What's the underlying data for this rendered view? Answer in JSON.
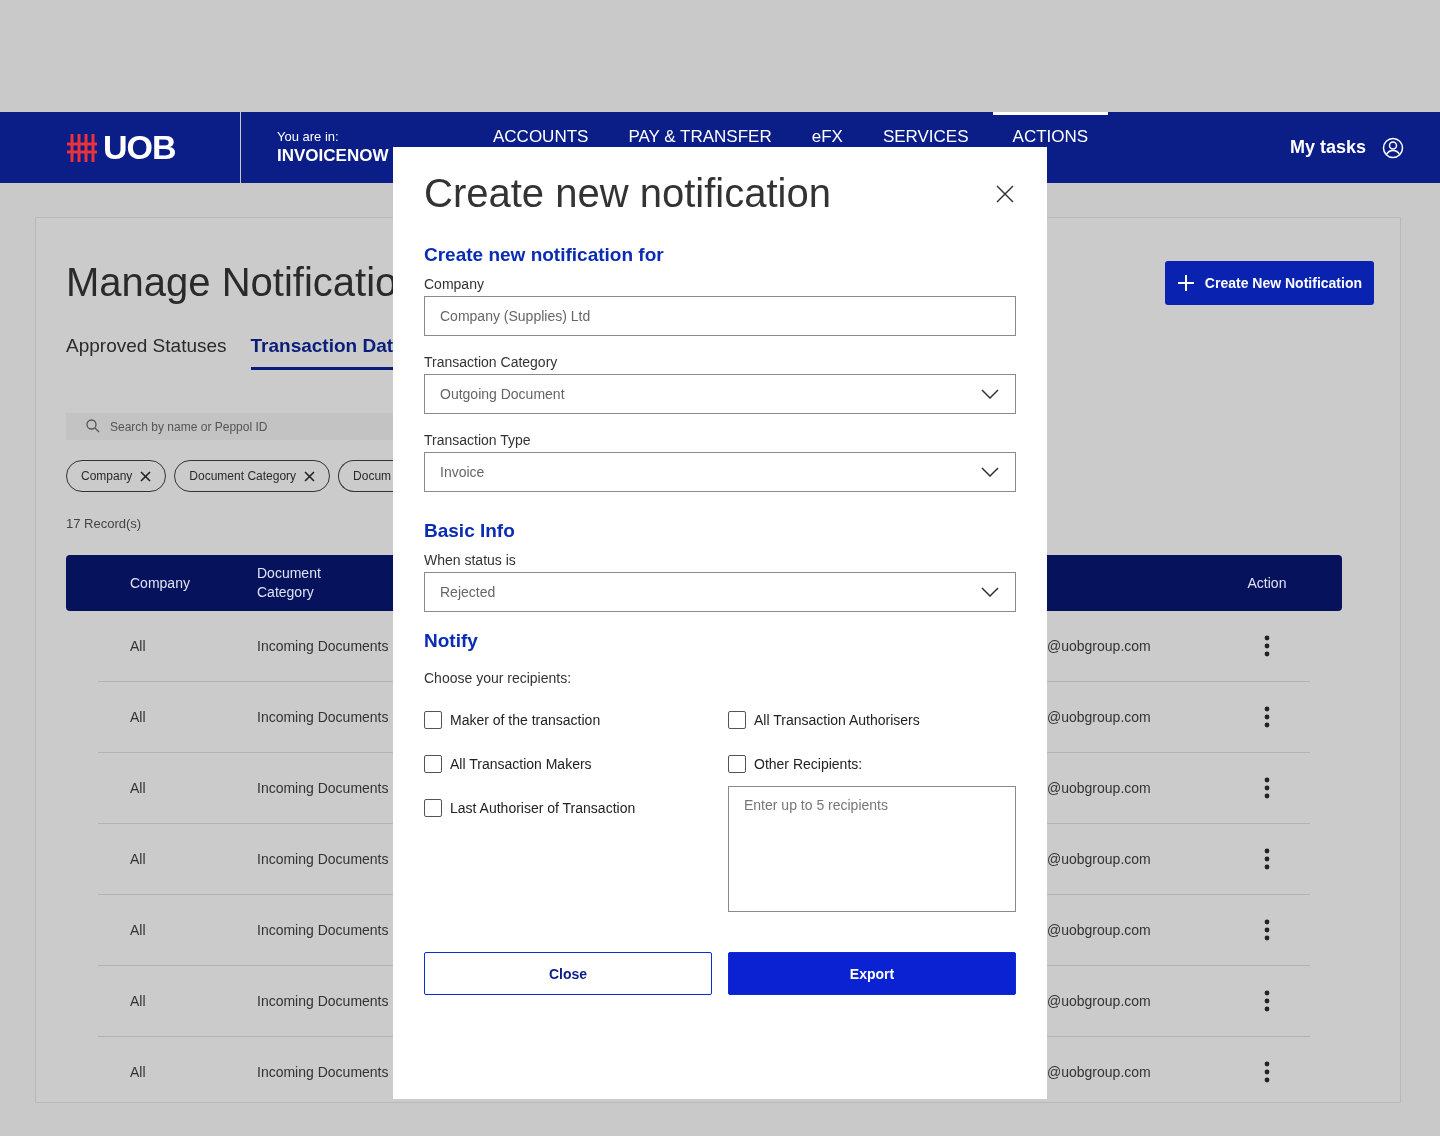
{
  "header": {
    "logo": "UOB",
    "location_label": "You are in:",
    "location": "INVOICENOW",
    "nav": [
      {
        "label": "ACCOUNTS",
        "selected": false
      },
      {
        "label": "PAY & TRANSFER",
        "selected": false
      },
      {
        "label": "eFX",
        "selected": false
      },
      {
        "label": "SERVICES",
        "selected": false
      },
      {
        "label": "ACTIONS",
        "selected": true
      }
    ],
    "my_tasks": "My tasks"
  },
  "page": {
    "title": "Manage Notificatio",
    "create_button": "Create New Notification",
    "tabs": [
      {
        "label": "Approved Statuses",
        "selected": false
      },
      {
        "label": "Transaction Dat",
        "selected": true
      }
    ],
    "search": {
      "placeholder": "Search by name or Peppol ID"
    },
    "filters": [
      {
        "label": "Company",
        "removable": true
      },
      {
        "label": "Document Category",
        "removable": true
      },
      {
        "label": "Docum",
        "removable": false
      }
    ],
    "records": "17 Record(s)",
    "table": {
      "columns": [
        "Company",
        "Document Category",
        "Action"
      ],
      "rows": [
        {
          "company": "All",
          "document_category": "Incoming Documents",
          "column_3": "@uobgroup.com"
        },
        {
          "company": "All",
          "document_category": "Incoming Documents",
          "column_3": "@uobgroup.com"
        },
        {
          "company": "All",
          "document_category": "Incoming Documents",
          "column_3": "@uobgroup.com"
        },
        {
          "company": "All",
          "document_category": "Incoming Documents",
          "column_3": "@uobgroup.com"
        },
        {
          "company": "All",
          "document_category": "Incoming Documents",
          "column_3": "@uobgroup.com"
        },
        {
          "company": "All",
          "document_category": "Incoming Documents",
          "column_3": "@uobgroup.com"
        },
        {
          "company": "All",
          "document_category": "Incoming Documents",
          "column_3": "@uobgroup.com"
        }
      ]
    }
  },
  "modal": {
    "title": "Create new notification",
    "sections": [
      {
        "heading": "Create new notification for",
        "fields": [
          {
            "kind": "text",
            "label": "Company",
            "value": "Company (Supplies) Ltd"
          },
          {
            "kind": "select",
            "label": "Transaction Category",
            "value": "Outgoing Document"
          },
          {
            "kind": "select",
            "label": "Transaction Type",
            "value": "Invoice"
          }
        ]
      },
      {
        "heading": "Basic Info",
        "fields": [
          {
            "kind": "select",
            "label": "When status is",
            "value": "Rejected"
          }
        ]
      }
    ],
    "notify": {
      "heading": "Notify",
      "prompt": "Choose your recipients:",
      "left": [
        {
          "label": "Maker of the transaction",
          "checked": false
        },
        {
          "label": "All Transaction Makers",
          "checked": false
        },
        {
          "label": "Last Authoriser of Transaction",
          "checked": false
        }
      ],
      "right": [
        {
          "label": "All Transaction Authorisers",
          "checked": false
        },
        {
          "label": "Other Recipients:",
          "checked": false
        }
      ],
      "recipients": {
        "placeholder": "Enter up to 5 recipients"
      }
    },
    "buttons": [
      {
        "label": "Close",
        "kind": "secondary"
      },
      {
        "label": "Export",
        "kind": "primary"
      }
    ]
  }
}
